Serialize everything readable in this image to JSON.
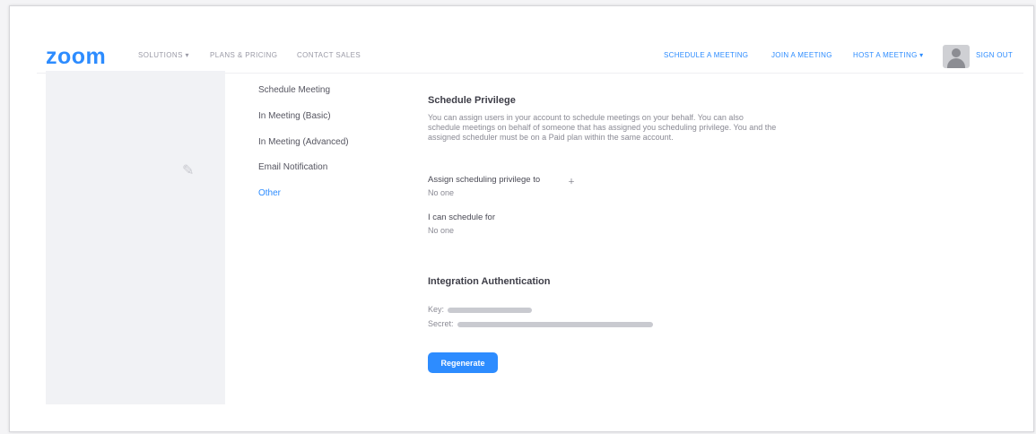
{
  "brand": {
    "logo": "zoom",
    "accent": "#2d8cff"
  },
  "nav": {
    "left": [
      {
        "label": "SOLUTIONS ▾"
      },
      {
        "label": "PLANS & PRICING"
      },
      {
        "label": "CONTACT SALES"
      }
    ],
    "right": [
      {
        "label": "SCHEDULE A MEETING"
      },
      {
        "label": "JOIN A MEETING"
      },
      {
        "label": "HOST A MEETING ▾"
      },
      {
        "label": "SIGN OUT"
      }
    ],
    "avatar_icon": "user-avatar-icon"
  },
  "settings_menu": [
    {
      "label": "Schedule Meeting",
      "active": false
    },
    {
      "label": "In Meeting (Basic)",
      "active": false
    },
    {
      "label": "In Meeting (Advanced)",
      "active": false
    },
    {
      "label": "Email Notification",
      "active": false
    },
    {
      "label": "Other",
      "active": true
    }
  ],
  "schedule_privilege": {
    "title": "Schedule Privilege",
    "description": "You can assign users in your account to schedule meetings on your behalf. You can also schedule meetings on behalf of someone that has assigned you scheduling privilege. You and the assigned scheduler must be on a Paid plan within the same account.",
    "assign_label": "Assign scheduling privilege to",
    "assign_value": "No one",
    "schedule_for_label": "I can schedule for",
    "schedule_for_value": "No one"
  },
  "integration": {
    "title": "Integration Authentication",
    "key_label": "Key:",
    "secret_label": "Secret:",
    "regenerate_label": "Regenerate"
  }
}
